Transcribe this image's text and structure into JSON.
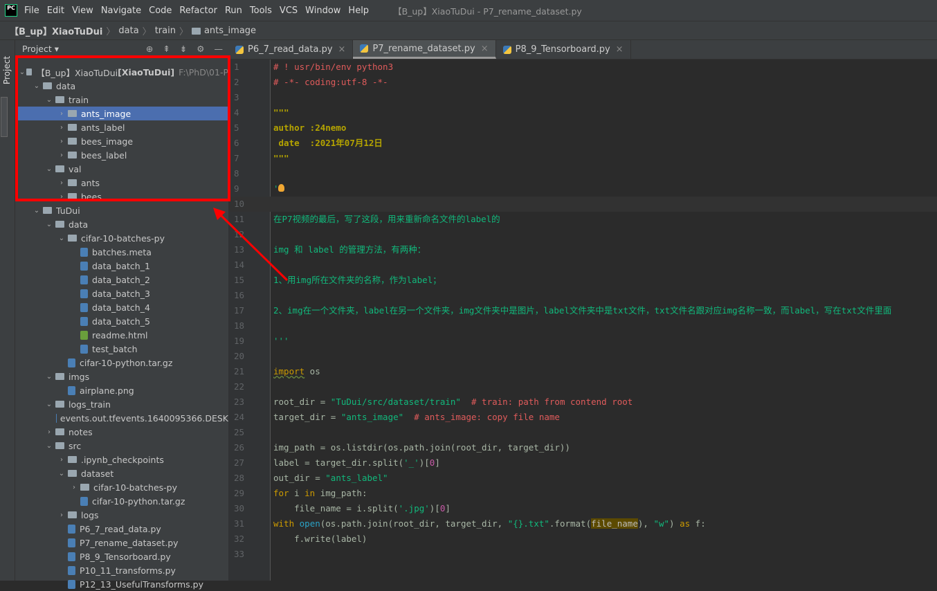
{
  "menubar": {
    "logo": "PC",
    "items": [
      "File",
      "Edit",
      "View",
      "Navigate",
      "Code",
      "Refactor",
      "Run",
      "Tools",
      "VCS",
      "Window",
      "Help"
    ],
    "window_title": "【B_up】XiaoTuDui - P7_rename_dataset.py"
  },
  "breadcrumb": [
    "【B_up】XiaoTuDui",
    "data",
    "train",
    "ants_image"
  ],
  "panel": {
    "title": "Project ▾",
    "strip_label": "Project"
  },
  "tree": [
    {
      "d": 0,
      "a": "v",
      "t": "dir",
      "label": "【B_up】XiaoTuDui",
      "extra": "[XiaoTuDui]",
      "hint": "F:\\PhD\\01-P"
    },
    {
      "d": 1,
      "a": "v",
      "t": "dir",
      "label": "data"
    },
    {
      "d": 2,
      "a": "v",
      "t": "dir",
      "label": "train"
    },
    {
      "d": 3,
      "a": ">",
      "t": "dir",
      "label": "ants_image",
      "sel": true
    },
    {
      "d": 3,
      "a": ">",
      "t": "dir",
      "label": "ants_label"
    },
    {
      "d": 3,
      "a": ">",
      "t": "dir",
      "label": "bees_image"
    },
    {
      "d": 3,
      "a": ">",
      "t": "dir",
      "label": "bees_label"
    },
    {
      "d": 2,
      "a": "v",
      "t": "dir",
      "label": "val"
    },
    {
      "d": 3,
      "a": ">",
      "t": "dir",
      "label": "ants"
    },
    {
      "d": 3,
      "a": ">",
      "t": "dir",
      "label": "bees"
    },
    {
      "d": 1,
      "a": "v",
      "t": "dir",
      "label": "TuDui"
    },
    {
      "d": 2,
      "a": "v",
      "t": "dir",
      "label": "data"
    },
    {
      "d": 3,
      "a": "v",
      "t": "dir",
      "label": "cifar-10-batches-py"
    },
    {
      "d": 4,
      "a": "",
      "t": "file",
      "label": "batches.meta"
    },
    {
      "d": 4,
      "a": "",
      "t": "file",
      "label": "data_batch_1"
    },
    {
      "d": 4,
      "a": "",
      "t": "file",
      "label": "data_batch_2"
    },
    {
      "d": 4,
      "a": "",
      "t": "file",
      "label": "data_batch_3"
    },
    {
      "d": 4,
      "a": "",
      "t": "file",
      "label": "data_batch_4"
    },
    {
      "d": 4,
      "a": "",
      "t": "file",
      "label": "data_batch_5"
    },
    {
      "d": 4,
      "a": "",
      "t": "html",
      "label": "readme.html"
    },
    {
      "d": 4,
      "a": "",
      "t": "file",
      "label": "test_batch"
    },
    {
      "d": 3,
      "a": "",
      "t": "file",
      "label": "cifar-10-python.tar.gz"
    },
    {
      "d": 2,
      "a": "v",
      "t": "dir",
      "label": "imgs"
    },
    {
      "d": 3,
      "a": "",
      "t": "file",
      "label": "airplane.png"
    },
    {
      "d": 2,
      "a": "v",
      "t": "dir",
      "label": "logs_train"
    },
    {
      "d": 3,
      "a": "",
      "t": "file",
      "label": "events.out.tfevents.1640095366.DESK"
    },
    {
      "d": 2,
      "a": ">",
      "t": "dir",
      "label": "notes"
    },
    {
      "d": 2,
      "a": "v",
      "t": "dir",
      "label": "src"
    },
    {
      "d": 3,
      "a": ">",
      "t": "dir",
      "label": ".ipynb_checkpoints"
    },
    {
      "d": 3,
      "a": "v",
      "t": "dir",
      "label": "dataset"
    },
    {
      "d": 4,
      "a": ">",
      "t": "dir",
      "label": "cifar-10-batches-py"
    },
    {
      "d": 4,
      "a": "",
      "t": "file",
      "label": "cifar-10-python.tar.gz"
    },
    {
      "d": 3,
      "a": ">",
      "t": "dir",
      "label": "logs"
    },
    {
      "d": 3,
      "a": "",
      "t": "file",
      "label": "P6_7_read_data.py"
    },
    {
      "d": 3,
      "a": "",
      "t": "file",
      "label": "P7_rename_dataset.py"
    },
    {
      "d": 3,
      "a": "",
      "t": "file",
      "label": "P8_9_Tensorboard.py"
    },
    {
      "d": 3,
      "a": "",
      "t": "file",
      "label": "P10_11_transforms.py"
    },
    {
      "d": 3,
      "a": "",
      "t": "file",
      "label": "P12_13_UsefulTransforms.py"
    }
  ],
  "tabs": [
    {
      "label": "P6_7_read_data.py"
    },
    {
      "label": "P7_rename_dataset.py",
      "active": true
    },
    {
      "label": "P8_9_Tensorboard.py"
    }
  ],
  "current_line": 10,
  "code": [
    [
      [
        "# ! usr/bin/env python3",
        "cm"
      ]
    ],
    [
      [
        "# -*- coding:utf-8 -*-",
        "cm"
      ]
    ],
    [],
    [
      [
        "\"\"\"",
        "doc"
      ]
    ],
    [
      [
        "author :24nemo",
        "doc"
      ]
    ],
    [
      [
        " date  :2021年07月12日",
        "doc"
      ]
    ],
    [
      [
        "\"\"\"",
        "doc"
      ]
    ],
    [],
    [
      [
        "'",
        "str"
      ]
    ],
    [],
    [
      [
        "在P7视频的最后，写了这段，用来重新命名文件的label的",
        "str"
      ]
    ],
    [],
    [
      [
        "img 和 label 的管理方法，有两种：",
        "str"
      ]
    ],
    [],
    [
      [
        "1、用img所在文件夹的名称，作为label；",
        "str"
      ]
    ],
    [],
    [
      [
        "2、img在一个文件夹，label在另一个文件夹，img文件夹中是图片，label文件夹中是txt文件，txt文件名跟对应img名称一致，而label，写在txt文件里面",
        "str"
      ]
    ],
    [],
    [
      [
        "'''",
        "str"
      ]
    ],
    [],
    [
      [
        "import",
        "imp"
      ],
      [
        " os",
        "id"
      ]
    ],
    [],
    [
      [
        "root_dir = ",
        "id"
      ],
      [
        "\"TuDui/src/dataset/train\"",
        "str"
      ],
      [
        "  # train: path from contend root",
        "cm"
      ]
    ],
    [
      [
        "target_dir = ",
        "id"
      ],
      [
        "\"ants_image\"",
        "str"
      ],
      [
        "  # ants_image: copy file name",
        "cm"
      ]
    ],
    [],
    [
      [
        "img_path = os.listdir(os.path.join(root_dir, target_dir))",
        "id"
      ]
    ],
    [
      [
        "label = target_dir.split(",
        "id"
      ],
      [
        "'_'",
        "str"
      ],
      [
        ")[",
        "id"
      ],
      [
        "0",
        "num"
      ],
      [
        "]",
        "id"
      ]
    ],
    [
      [
        "out_dir = ",
        "id"
      ],
      [
        "\"ants_label\"",
        "str"
      ]
    ],
    [
      [
        "for",
        "kw"
      ],
      [
        " i ",
        "id"
      ],
      [
        "in",
        "kw"
      ],
      [
        " img_path:",
        "id"
      ]
    ],
    [
      [
        "    file_name = i.split(",
        "id"
      ],
      [
        "'.jpg'",
        "str"
      ],
      [
        ")[",
        "id"
      ],
      [
        "0",
        "num"
      ],
      [
        "]",
        "id"
      ]
    ],
    [
      [
        "with",
        "kw"
      ],
      [
        " ",
        "id"
      ],
      [
        "open",
        "bi"
      ],
      [
        "(os.path.join(root_dir, target_dir, ",
        "id"
      ],
      [
        "\"{}.txt\"",
        "str"
      ],
      [
        ".format(",
        "id"
      ],
      [
        "file_name",
        "hl"
      ],
      [
        "), ",
        "id"
      ],
      [
        "\"w\"",
        "str"
      ],
      [
        ") ",
        "id"
      ],
      [
        "as",
        "kw"
      ],
      [
        " f:",
        "id"
      ]
    ],
    [
      [
        "    f.write(label)",
        "id"
      ]
    ],
    []
  ],
  "annotation_color": "#ff0000"
}
